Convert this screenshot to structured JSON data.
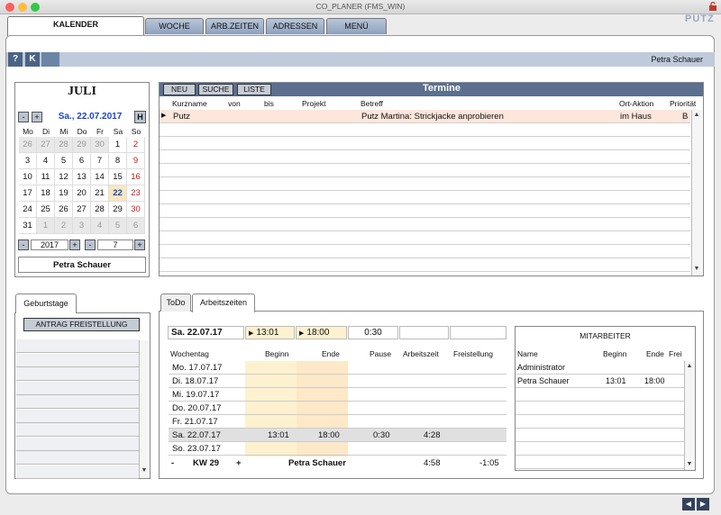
{
  "window": {
    "title": "CO_PLANER (FMS_WIN)"
  },
  "logo": "PUTZ",
  "tabs": [
    {
      "label": "KALENDER"
    },
    {
      "label": "WOCHE"
    },
    {
      "label": "ARB.ZEITEN"
    },
    {
      "label": "ADRESSEN"
    },
    {
      "label": "MENÜ"
    }
  ],
  "toolbar": {
    "help_label": "?",
    "k_label": "K",
    "user": "Petra Schauer"
  },
  "calendar": {
    "month": "JULI",
    "prev": "-",
    "next": "+",
    "today_btn": "H",
    "current_date": "Sa., 22.07.2017",
    "weekdays": [
      "Mo",
      "Di",
      "Mi",
      "Do",
      "Fr",
      "Sa",
      "So"
    ],
    "weeks": [
      [
        "26",
        "27",
        "28",
        "29",
        "30",
        "1",
        "2"
      ],
      [
        "3",
        "4",
        "5",
        "6",
        "7",
        "8",
        "9"
      ],
      [
        "10",
        "11",
        "12",
        "13",
        "14",
        "15",
        "16"
      ],
      [
        "17",
        "18",
        "19",
        "20",
        "21",
        "22",
        "23"
      ],
      [
        "24",
        "25",
        "26",
        "27",
        "28",
        "29",
        "30"
      ],
      [
        "31",
        "1",
        "2",
        "3",
        "4",
        "5",
        "6"
      ]
    ],
    "year": "2017",
    "month_num": "7",
    "user": "Petra Schauer"
  },
  "termine": {
    "buttons": [
      "NEU",
      "SUCHE",
      "LISTE"
    ],
    "title": "Termine",
    "columns": [
      "Kurzname",
      "von",
      "bis",
      "Projekt",
      "Betreff",
      "Ort-Aktion",
      "Priorität"
    ],
    "rows": [
      {
        "kurzname": "Putz",
        "von": "",
        "bis": "",
        "projekt": "",
        "betreff": "Putz Martina: Strickjacke anprobieren",
        "ort": "im Haus",
        "prio": "B"
      }
    ]
  },
  "geburtstage": {
    "tab": "Geburtstage",
    "button": "ANTRAG FREISTELLUNG"
  },
  "zeiten": {
    "tabs": [
      "ToDo",
      "Arbeitszeiten"
    ],
    "header": {
      "date": "Sa.  22.07.17",
      "beginn": "13:01",
      "ende": "18:00",
      "pause": "0:30"
    },
    "columns": [
      "Wochentag",
      "Beginn",
      "Ende",
      "Pause",
      "Arbeitszeit",
      "Freistellung"
    ],
    "rows": [
      {
        "tag": "Mo.  17.07.17",
        "beginn": "",
        "ende": "",
        "pause": "",
        "az": ""
      },
      {
        "tag": "Di.   18.07.17",
        "beginn": "",
        "ende": "",
        "pause": "",
        "az": ""
      },
      {
        "tag": "Mi.   19.07.17",
        "beginn": "",
        "ende": "",
        "pause": "",
        "az": ""
      },
      {
        "tag": "Do.  20.07.17",
        "beginn": "",
        "ende": "",
        "pause": "",
        "az": ""
      },
      {
        "tag": "Fr.   21.07.17",
        "beginn": "",
        "ende": "",
        "pause": "",
        "az": ""
      },
      {
        "tag": "Sa.  22.07.17",
        "beginn": "13:01",
        "ende": "18:00",
        "pause": "0:30",
        "az": "4:28"
      },
      {
        "tag": "So.  23.07.17",
        "beginn": "",
        "ende": "",
        "pause": "",
        "az": ""
      }
    ],
    "footer": {
      "minus": "-",
      "kw": "KW 29",
      "plus": "+",
      "name": "Petra Schauer",
      "total": "4:58",
      "diff": "-1:05"
    }
  },
  "mitarbeiter": {
    "title": "MITARBEITER",
    "columns": [
      "Name",
      "Beginn",
      "Ende",
      "Frei"
    ],
    "rows": [
      {
        "name": "Administrator",
        "beginn": "",
        "ende": ""
      },
      {
        "name": "Petra Schauer",
        "beginn": "13:01",
        "ende": "18:00"
      }
    ]
  }
}
